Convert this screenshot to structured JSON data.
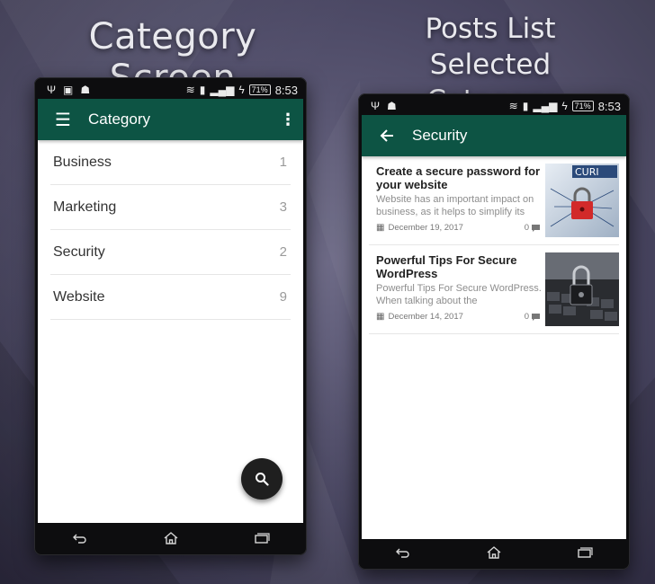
{
  "headings": {
    "left": "Category Screen",
    "right_line1": "Posts List",
    "right_line2": "Selected Category"
  },
  "status_bar": {
    "time": "8:53",
    "battery": "71%"
  },
  "category_screen": {
    "title": "Category",
    "categories": [
      {
        "name": "Business",
        "count": "1"
      },
      {
        "name": "Marketing",
        "count": "3"
      },
      {
        "name": "Security",
        "count": "2"
      },
      {
        "name": "Website",
        "count": "9"
      }
    ],
    "fab_icon": "search-icon"
  },
  "posts_screen": {
    "title": "Security",
    "posts": [
      {
        "title": "Create a secure password for your website",
        "excerpt": "Website has an important impact on business, as it helps to simplify its",
        "date": "December 19, 2017",
        "comments": "0",
        "thumb_text": "CURI"
      },
      {
        "title": "Powerful Tips For Secure WordPress",
        "excerpt": "Powerful Tips For Secure WordPress. When talking about the",
        "date": "December 14, 2017",
        "comments": "0"
      }
    ]
  },
  "colors": {
    "app_bar": "#0d5444",
    "fab": "#1f1f1f",
    "background": "#4d4a66"
  }
}
